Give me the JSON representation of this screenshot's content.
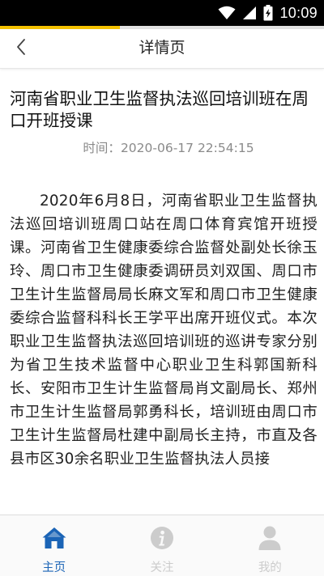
{
  "status_bar": {
    "time": "10:09"
  },
  "header": {
    "title": "详情页",
    "back_icon": "chevron-left-icon"
  },
  "article": {
    "title": "河南省职业卫生监督执法巡回培训班在周口开班授课",
    "meta_label": "时间：",
    "meta_time": "2020-06-17 22:54:15",
    "body": "2020年6月8日，河南省职业卫生监督执法巡回培训班周口站在周口体育宾馆开班授课。河南省卫生健康委综合监督处副处长徐玉玲、周口市卫生健康委调研员刘双国、周口市卫生计生监督局局长麻文军和周口市卫生健康委综合监督科科长王学平出席开班仪式。本次职业卫生监督执法巡回培训班的巡讲专家分别为省卫生技术监督中心职业卫生科郭国新科长、安阳市卫生计生监督局肖文副局长、郑州市卫生计生监督局郭勇科长，培训班由周口市卫生计生监督局杜建中副局长主持，市直及各县市区30余名职业卫生监督执法人员接"
  },
  "tabs": [
    {
      "label": "主页",
      "icon": "home-icon",
      "active": true
    },
    {
      "label": "关注",
      "icon": "info-icon",
      "active": false
    },
    {
      "label": "我的",
      "icon": "user-icon",
      "active": false
    }
  ],
  "colors": {
    "accent": "#f5c200",
    "tab_active": "#1b64b6",
    "tab_inactive": "#cccccc",
    "status_bar": "#000000"
  },
  "progress_fraction": 0.37
}
